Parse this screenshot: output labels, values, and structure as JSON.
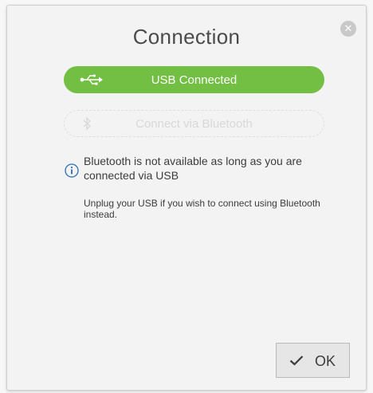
{
  "dialog": {
    "title": "Connection",
    "close_icon": "close-icon",
    "usb_button": {
      "label": "USB Connected",
      "icon": "usb-icon",
      "color": "#72bf44"
    },
    "bluetooth_button": {
      "label": "Connect via Bluetooth",
      "icon": "bluetooth-icon",
      "state": "disabled"
    },
    "info": {
      "icon": "info-icon",
      "text": "Bluetooth is not available as long as you are connected via USB"
    },
    "unplug_text": "Unplug your USB if you wish to connect using Bluetooth instead.",
    "ok_button": {
      "label": "OK",
      "icon": "checkmark-icon"
    }
  }
}
